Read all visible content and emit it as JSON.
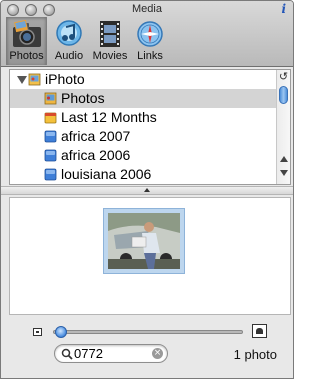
{
  "window": {
    "title": "Media",
    "info_label": "i"
  },
  "toolbar": {
    "tabs": [
      {
        "label": "Photos",
        "icon": "photos-icon",
        "selected": true
      },
      {
        "label": "Audio",
        "icon": "audio-icon",
        "selected": false
      },
      {
        "label": "Movies",
        "icon": "movies-icon",
        "selected": false
      },
      {
        "label": "Links",
        "icon": "links-icon",
        "selected": false
      }
    ]
  },
  "source_list": {
    "root": {
      "label": "iPhoto",
      "icon": "iphoto-icon",
      "expanded": true
    },
    "items": [
      {
        "label": "Photos",
        "icon": "photos-library-icon",
        "selected": true
      },
      {
        "label": "Last 12 Months",
        "icon": "smart-album-icon",
        "selected": false
      },
      {
        "label": "africa 2007",
        "icon": "album-icon",
        "selected": false
      },
      {
        "label": "africa 2006",
        "icon": "album-icon",
        "selected": false
      },
      {
        "label": "louisiana 2006",
        "icon": "album-icon",
        "selected": false
      }
    ]
  },
  "browser": {
    "thumbnail_icon": "photo-thumbnail"
  },
  "bottom_bar": {
    "zoom_level": 0.02,
    "search": {
      "value": "0772",
      "placeholder": ""
    },
    "count_label": "1 photo"
  },
  "colors": {
    "selection_blue": "#4d8fe0",
    "row_selected": "#d4d4d4",
    "album_blue": "#3f7fd8"
  }
}
